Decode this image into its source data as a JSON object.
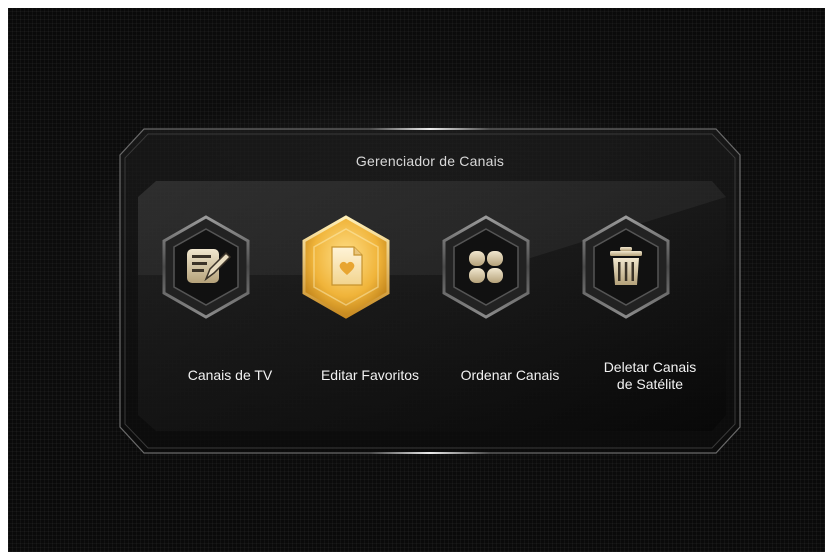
{
  "panel": {
    "title": "Gerenciador de Canais"
  },
  "menu": {
    "items": [
      {
        "label": "Canais de TV",
        "icon": "edit-document-icon",
        "selected": false
      },
      {
        "label": "Editar Favoritos",
        "icon": "favorite-document-icon",
        "selected": true
      },
      {
        "label": "Ordenar Canais",
        "icon": "four-petal-sort-icon",
        "selected": false
      },
      {
        "label_line1": "Deletar Canais",
        "label_line2": "de Satélite",
        "icon": "trash-can-icon",
        "selected": false
      }
    ]
  },
  "colors": {
    "background": "#0a0a0a",
    "selected_accent": "#f0b43a",
    "icon_face": "#d8cfb8",
    "text": "#f2f2f2"
  }
}
